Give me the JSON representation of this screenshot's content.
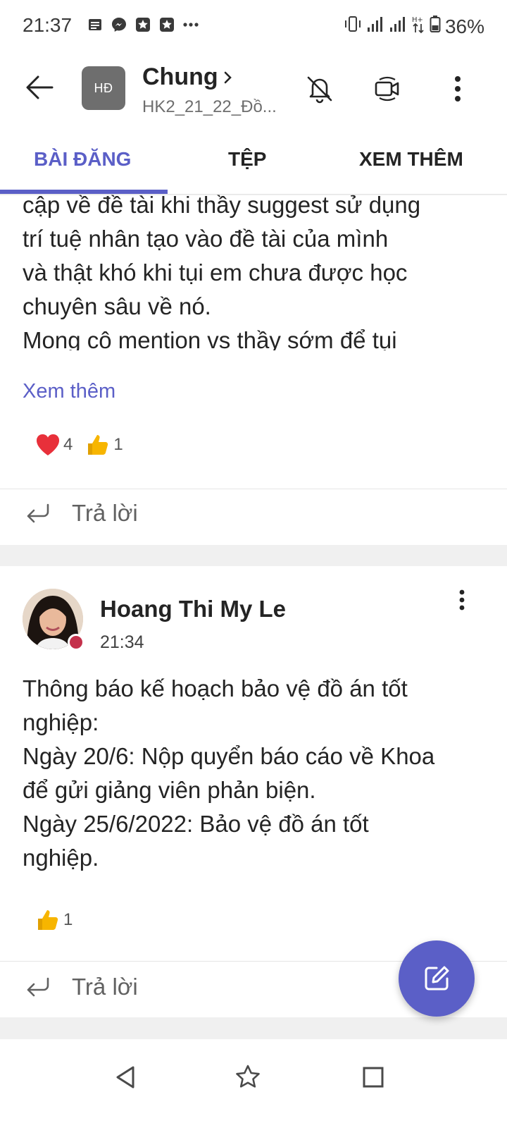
{
  "status_bar": {
    "time": "21:37",
    "battery": "36%",
    "notification_icons": [
      "news-icon",
      "messenger-icon",
      "app-star-icon",
      "app-star-icon",
      "more-dots-icon"
    ]
  },
  "header": {
    "team_initials": "HĐ",
    "channel_name": "Chung",
    "team_name": "HK2_21_22_Đồ..."
  },
  "tabs": [
    {
      "label": "BÀI ĐĂNG",
      "active": true
    },
    {
      "label": "TỆP",
      "active": false
    },
    {
      "label": "XEM THÊM",
      "active": false
    }
  ],
  "posts": [
    {
      "lines": [
        "cập về đề tài khi thầy suggest sử dụng",
        "trí tuệ nhân tạo vào đề tài của mình",
        "và thật khó khi tụi em chưa được học",
        "chuyên sâu về nó.",
        "Mong cô mention vs thầy sớm để tụi"
      ],
      "see_more": "Xem thêm",
      "reactions": [
        {
          "icon": "heart-icon",
          "count": "4"
        },
        {
          "icon": "thumbs-up-icon",
          "count": "1"
        }
      ],
      "reply_label": "Trả lời"
    },
    {
      "author": "Hoang Thi My Le",
      "time": "21:34",
      "lines": [
        "Thông báo kế hoạch bảo vệ đồ án tốt",
        "nghiệp:",
        "Ngày 20/6: Nộp quyển báo cáo về Khoa",
        "để gửi giảng viên phản biện.",
        "Ngày 25/6/2022: Bảo vệ đồ án tốt",
        "nghiệp."
      ],
      "reactions": [
        {
          "icon": "thumbs-up-icon",
          "count": "1"
        }
      ],
      "reply_label": "Trả lời"
    }
  ],
  "colors": {
    "accent": "#5b5fc7",
    "presence_busy": "#c4314b",
    "heart": "#e8303a",
    "thumb": "#f7b500"
  }
}
